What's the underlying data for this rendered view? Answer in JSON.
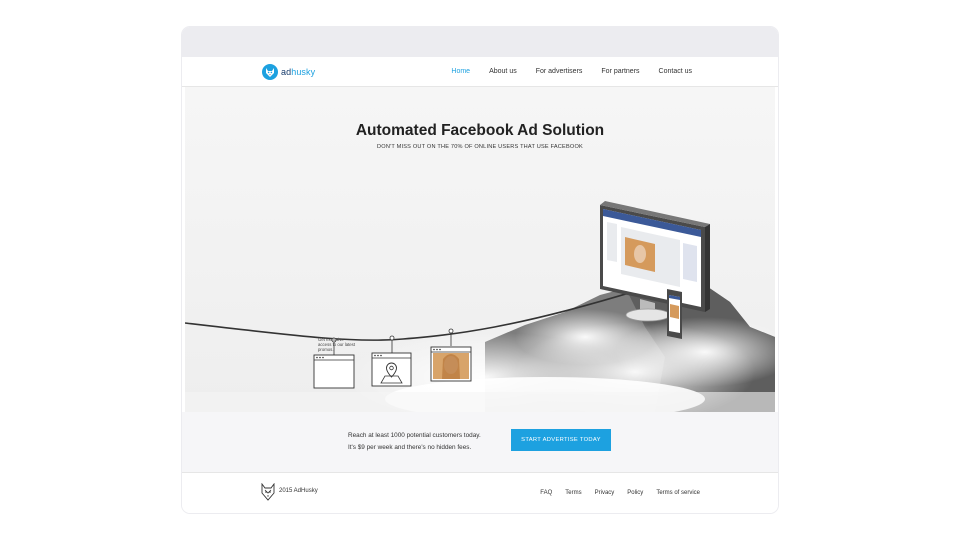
{
  "brand": {
    "logo_prefix": "ad",
    "logo_suffix": "husky",
    "accent": "#1da1e0",
    "dark": "#173b6b",
    "logo_icon": "husky-icon"
  },
  "nav": {
    "items": [
      {
        "label": "Home",
        "active": true
      },
      {
        "label": "About us",
        "active": false
      },
      {
        "label": "For advertisers",
        "active": false
      },
      {
        "label": "For partners",
        "active": false
      },
      {
        "label": "Contact us",
        "active": false
      }
    ]
  },
  "hero": {
    "title": "Automated Facebook Ad Solution",
    "subtitle": "DON'T MISS OUT ON THE 70% OF ONLINE USERS THAT USE FACEBOOK",
    "card_text": "Get exclusive access to our latest promos."
  },
  "cta": {
    "line1": "Reach at least 1000 potential customers today.",
    "line2": "It's $9 per week and there's no hidden fees.",
    "button_label": "START ADVERTISE TODAY"
  },
  "footer": {
    "copyright": "2015 AdHusky",
    "links": [
      "FAQ",
      "Terms",
      "Privacy",
      "Policy",
      "Terms of service"
    ]
  }
}
